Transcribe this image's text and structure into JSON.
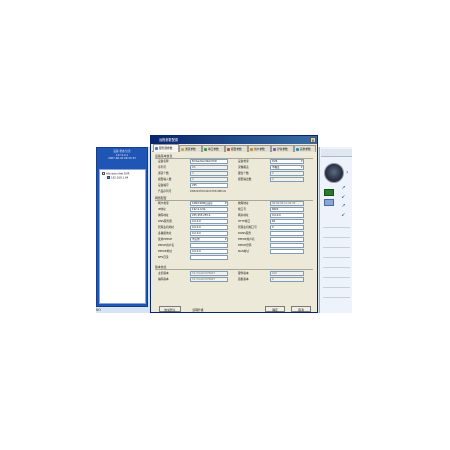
{
  "left_panel": {
    "header_lines": [
      "设备 状态 信息",
      "127.0.0.1",
      "2007-06-20 09:45:33"
    ],
    "tree": [
      "Hikvision Net DVR",
      "192.168.1.64"
    ]
  },
  "bottom_label": "NO",
  "dialog": {
    "title": "远程参数配置",
    "close": "×",
    "tabs": [
      {
        "label": "服务器参数",
        "color": "#3b7bd6"
      },
      {
        "label": "通道参数",
        "color": "#e2a02a"
      },
      {
        "label": "串口参数",
        "color": "#3a9a3a"
      },
      {
        "label": "报警参数",
        "color": "#d6442a"
      },
      {
        "label": "用户参数",
        "color": "#c09020"
      },
      {
        "label": "异常参数",
        "color": "#7a5ab8"
      },
      {
        "label": "其他参数",
        "color": "#2a8ab8"
      }
    ],
    "section1": {
      "title": "设备基本信息",
      "rows": [
        {
          "l1": "设备名称",
          "v1": "Embedded Net DVR",
          "l2": "设备类型",
          "v2": "DVR"
        },
        {
          "l1": "序列号",
          "v1": "DS",
          "l2": "录像覆盖",
          "v2": "不覆盖"
        },
        {
          "l1": "通道个数",
          "v1": "4",
          "l2": "硬盘个数",
          "v2": "0"
        },
        {
          "l1": "报警输入数",
          "v1": "4",
          "l2": "报警输出数",
          "v2": "4"
        },
        {
          "l1": "设备编号",
          "v1": "255",
          "l2": "",
          "v2": ""
        }
      ],
      "product_label": "产品序列号",
      "product_value": "DS8004HC0420070520BCVA"
    },
    "section2": {
      "title": "网络配置",
      "rows": [
        {
          "l1": "网卡类型",
          "v1": "10M/100M自适应",
          "l2": "物理地址",
          "v2": "00:40:30:11:22:33"
        },
        {
          "l1": "IP地址",
          "v1": "192.0.0.64",
          "l2": "端口号",
          "v2": "8000"
        },
        {
          "l1": "掩码地址",
          "v1": "255.255.255.0",
          "l2": "网关地址",
          "v2": "0.0.0.0"
        },
        {
          "l1": "DNS服务器",
          "v1": "0.0.0.0",
          "l2": "HTTP端口",
          "v2": "80"
        },
        {
          "l1": "管理主机地址",
          "v1": "0.0.0.0",
          "l2": "管理主机端口号",
          "v2": "0"
        },
        {
          "l1": "多播组地址",
          "v1": "0.0.0.0",
          "l2": "DDNS服务",
          "v2": ""
        },
        {
          "l1": "使用PPPOE",
          "v1": "不启用",
          "l2": "PPPOE用户名",
          "v2": ""
        },
        {
          "l1": "PPPoE用户名",
          "v1": "",
          "l2": "PPPoE密码",
          "v2": ""
        },
        {
          "l1": "PPPOE地址",
          "v1": "0.0.0.0",
          "l2": "NAS地址",
          "v2": ""
        },
        {
          "l1": "NFS目录",
          "v1": "",
          "l2": "",
          "v2": ""
        }
      ]
    },
    "section3": {
      "title": "版本信息",
      "rows": [
        {
          "l1": "主控版本",
          "v1": "V1.3 build 070613",
          "l2": "硬件版本",
          "v2": "0x0"
        },
        {
          "l1": "编码版本",
          "v1": "V1.3 build 070607",
          "l2": "面板版本",
          "v2": "0"
        }
      ]
    },
    "footer": {
      "left": "恢复默认",
      "mid": "远程升级",
      "ok": "确定",
      "cancel": "取消"
    }
  }
}
